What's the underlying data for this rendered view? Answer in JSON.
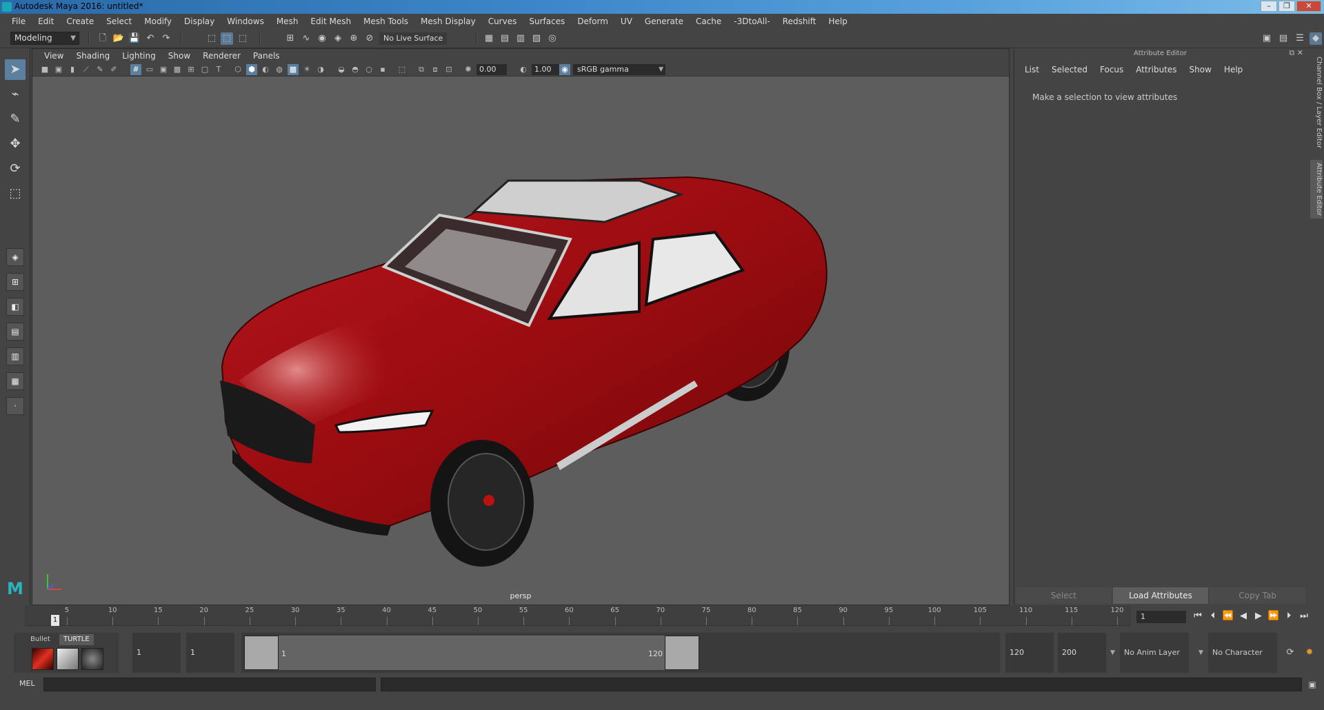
{
  "window": {
    "title": "Autodesk Maya 2016: untitled*"
  },
  "menubar": [
    "File",
    "Edit",
    "Create",
    "Select",
    "Modify",
    "Display",
    "Windows",
    "Mesh",
    "Edit Mesh",
    "Mesh Tools",
    "Mesh Display",
    "Curves",
    "Surfaces",
    "Deform",
    "UV",
    "Generate",
    "Cache",
    "-3DtoAll-",
    "Redshift",
    "Help"
  ],
  "statusline": {
    "mode": "Modeling",
    "live_surface": "No Live Surface"
  },
  "panel": {
    "menu": [
      "View",
      "Shading",
      "Lighting",
      "Show",
      "Renderer",
      "Panels"
    ],
    "field_a": "0.00",
    "field_b": "1.00",
    "color_space": "sRGB gamma",
    "camera": "persp"
  },
  "attribute_editor": {
    "title": "Attribute Editor",
    "menu": [
      "List",
      "Selected",
      "Focus",
      "Attributes",
      "Show",
      "Help"
    ],
    "message": "Make a selection to view attributes",
    "buttons": {
      "select": "Select",
      "load": "Load Attributes",
      "copy": "Copy Tab"
    }
  },
  "side_tabs": {
    "channel_box": "Channel Box / Layer Editor",
    "attribute_editor": "Attribute Editor"
  },
  "timeline": {
    "ticks": [
      "5",
      "10",
      "15",
      "20",
      "25",
      "30",
      "35",
      "40",
      "45",
      "50",
      "55",
      "60",
      "65",
      "70",
      "75",
      "80",
      "85",
      "90",
      "95",
      "100",
      "105",
      "110",
      "115",
      "120"
    ],
    "current_marker": "1",
    "current_frame": "1"
  },
  "range": {
    "shelf_tabs": [
      "Bullet",
      "TURTLE"
    ],
    "start": "1",
    "playback_start": "1",
    "range_start_label": "1",
    "range_end_label": "120",
    "playback_end": "120",
    "end": "200",
    "anim_layer": "No Anim Layer",
    "character_set": "No Character Set"
  },
  "command": {
    "language": "MEL"
  },
  "colors": {
    "body_paint": "#a10c10",
    "selection": "#5b7f9f",
    "viewport_bg": "#5d5d5d"
  }
}
